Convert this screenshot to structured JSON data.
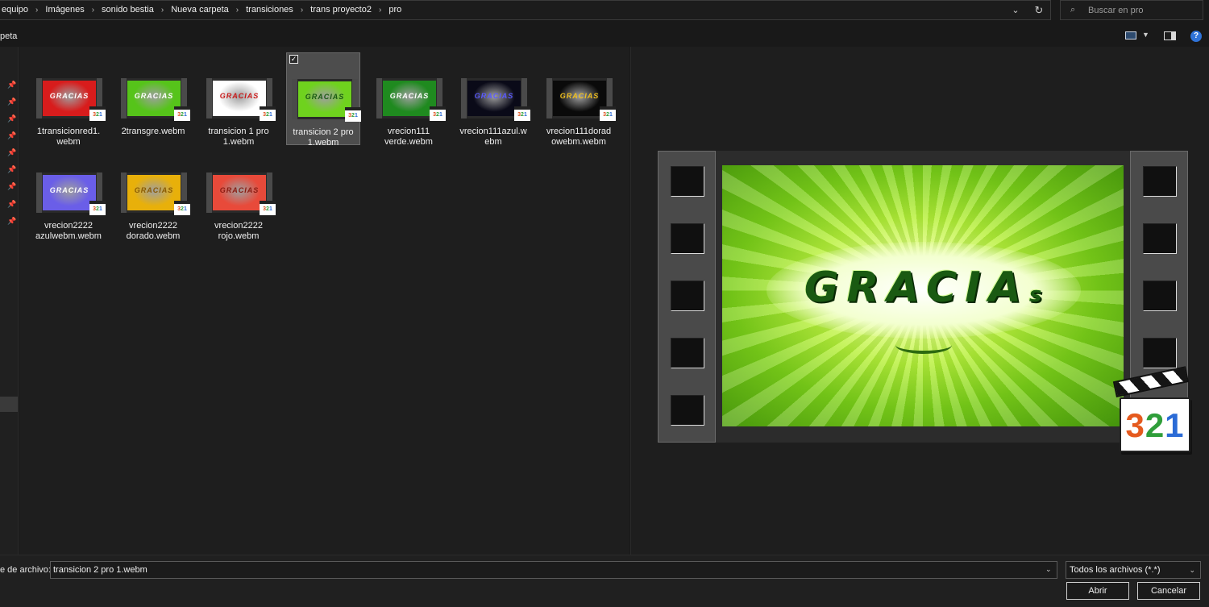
{
  "address": {
    "crumbs": [
      "equipo",
      "Imágenes",
      "sonido bestia",
      "Nueva carpeta",
      "transiciones",
      "trans proyecto2",
      "pro"
    ]
  },
  "search": {
    "placeholder": "Buscar en pro"
  },
  "toolbar": {
    "folder_label": "peta"
  },
  "files": [
    {
      "name": "1transicionred1.\nwebm",
      "color": "#d81c1c",
      "selected": false
    },
    {
      "name": "2transgre.webm",
      "color": "#56c41a",
      "selected": false
    },
    {
      "name": "transicion 1 pro\n1.webm",
      "color": "#ffffff",
      "selected": false
    },
    {
      "name": "transicion 2 pro\n1.webm",
      "color": "#6fd21e",
      "selected": true
    },
    {
      "name": "vrecion111\nverde.webm",
      "color": "#1f8a1f",
      "selected": false
    },
    {
      "name": "vrecion111azul.w\nebm",
      "color": "#0a0a18",
      "selected": false
    },
    {
      "name": "vrecion111dorad\nowebm.webm",
      "color": "#0a0a0a",
      "selected": false
    },
    {
      "name": "vrecion2222\nazulwebm.webm",
      "color": "#6a5ee8",
      "selected": false
    },
    {
      "name": "vrecion2222\ndorado.webm",
      "color": "#e8b00a",
      "selected": false
    },
    {
      "name": "vrecion2222\nrojo.webm",
      "color": "#e84a3a",
      "selected": false
    }
  ],
  "preview": {
    "title_text": "GRACIA",
    "title_suffix": "s",
    "logo_text": [
      "3",
      "2",
      "1"
    ]
  },
  "bottom": {
    "filename_label": "e de archivo:",
    "filename_value": "transicion 2 pro 1.webm",
    "filetype": "Todos los archivos (*.*)",
    "open_label": "Abrir",
    "cancel_label": "Cancelar"
  }
}
